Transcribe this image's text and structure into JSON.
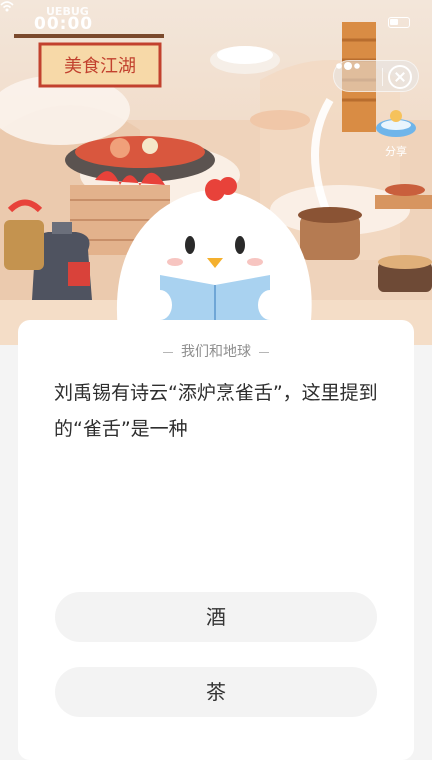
{
  "status_bar": {
    "time": "00:00",
    "watermark": "UEBUG"
  },
  "hero": {
    "sign_text": "美食江湖",
    "share_label": "分享"
  },
  "quiz": {
    "category": "我们和地球",
    "question": "刘禹锡有诗云“添炉烹雀舌”，这里提到的“雀舌”是一种",
    "options": [
      "酒",
      "茶"
    ]
  },
  "colors": {
    "card_bg": "#ffffff",
    "option_bg": "#f3f3f3",
    "accent_red": "#e8423a"
  },
  "icons": [
    "signal-icon",
    "battery-icon",
    "more-dots-icon",
    "close-icon",
    "share-icon"
  ]
}
